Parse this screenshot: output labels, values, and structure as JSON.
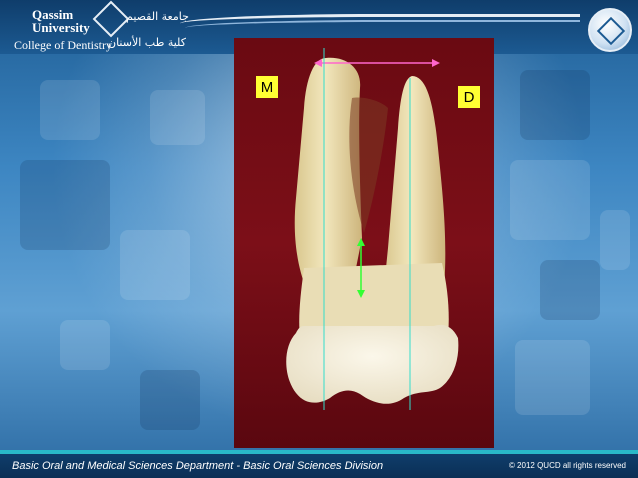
{
  "header": {
    "university_name_line1": "Qassim",
    "university_name_line2": "University",
    "university_name_arabic": "جامعة القصيم",
    "college_name": "College of Dentistry",
    "college_name_arabic": "كلية طب الأسنان",
    "emblem_icon": "university-emblem-icon"
  },
  "slide": {
    "image_labels": {
      "mesial": "M",
      "distal": "D"
    },
    "measurement_line_color": "#ff66cc",
    "vertical_line_color": "#33ddcc",
    "arrow_color": "#33ff33"
  },
  "footer": {
    "department": "Basic Oral and Medical Sciences Department - Basic Oral Sciences Division",
    "copyright": "© 2012 QUCD all rights reserved"
  },
  "colors": {
    "header_bg": "#0f3d6b",
    "footer_accent": "#29b8c8",
    "label_bg": "#ffff33",
    "photo_bg": "#6a0a12"
  }
}
